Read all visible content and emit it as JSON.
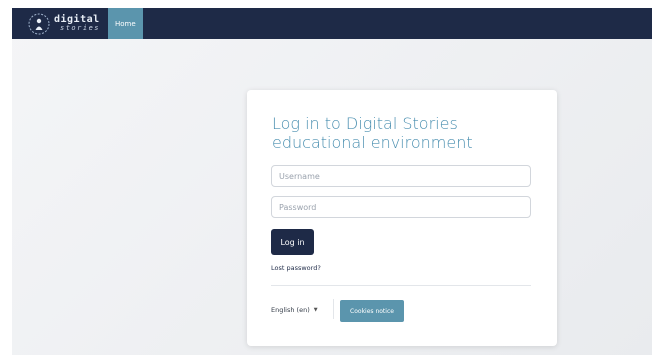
{
  "navbar": {
    "logo_line1": "digital",
    "logo_line2": "stories",
    "logo_icon": "digital-stories-logo",
    "home_label": "Home"
  },
  "login": {
    "title": "Log in to Digital Stories educational environment",
    "username_placeholder": "Username",
    "password_placeholder": "Password",
    "login_button": "Log in",
    "lost_password": "Lost password?"
  },
  "footer": {
    "language": "English (en)",
    "cookies_button": "Cookies notice"
  },
  "colors": {
    "navbar": "#1e2a47",
    "accent": "#5b95ad",
    "title": "#4a8fb0"
  }
}
